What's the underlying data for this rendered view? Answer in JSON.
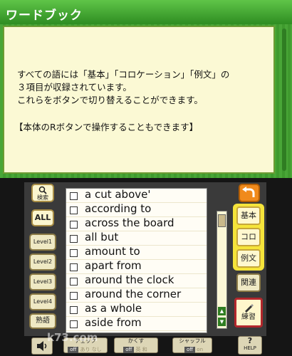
{
  "header": {
    "title": "ワードブック"
  },
  "message": {
    "lines": [
      "すべての語には「基本」「コロケーション」「例文」の",
      "３項目が収録されています。",
      "これらをボタンで切り替えることができます。",
      "【本体のRボタンで操作することもできます】"
    ]
  },
  "left_panel": {
    "search_label": "検索",
    "all_label": "ALL",
    "levels": [
      "Level1",
      "Level2",
      "Level3",
      "Level4"
    ],
    "extra_label": "熟語"
  },
  "word_list": {
    "items": [
      "a cut above'",
      "according to",
      "across the board",
      "all but",
      "amount to",
      "apart from",
      "around the clock",
      "around the corner",
      "as a whole",
      "aside from"
    ]
  },
  "right_panel": {
    "tabs": [
      "基本",
      "コロ",
      "例文"
    ],
    "related_label": "関連",
    "practice_label": "練習"
  },
  "bottom_bar": {
    "check": {
      "label": "チェック",
      "off": "off",
      "a": "あり",
      "b": "なし"
    },
    "hide": {
      "label": "かくす",
      "off": "off",
      "a": "英",
      "b": "和"
    },
    "shuffle": {
      "label": "シャッフル",
      "off": "off",
      "a": "on"
    },
    "help_label": "HELP"
  },
  "watermark": "k73.com",
  "colors": {
    "accent_green": "#3f9d2f",
    "panel_cream": "#fbf9d4",
    "tab_yellow": "#f5e43a",
    "back_orange": "#f08a1c"
  },
  "icons": [
    "search-icon",
    "back-arrow-icon",
    "pencil-icon",
    "speaker-icon",
    "question-icon",
    "scroll-up-icon",
    "scroll-down-icon"
  ]
}
